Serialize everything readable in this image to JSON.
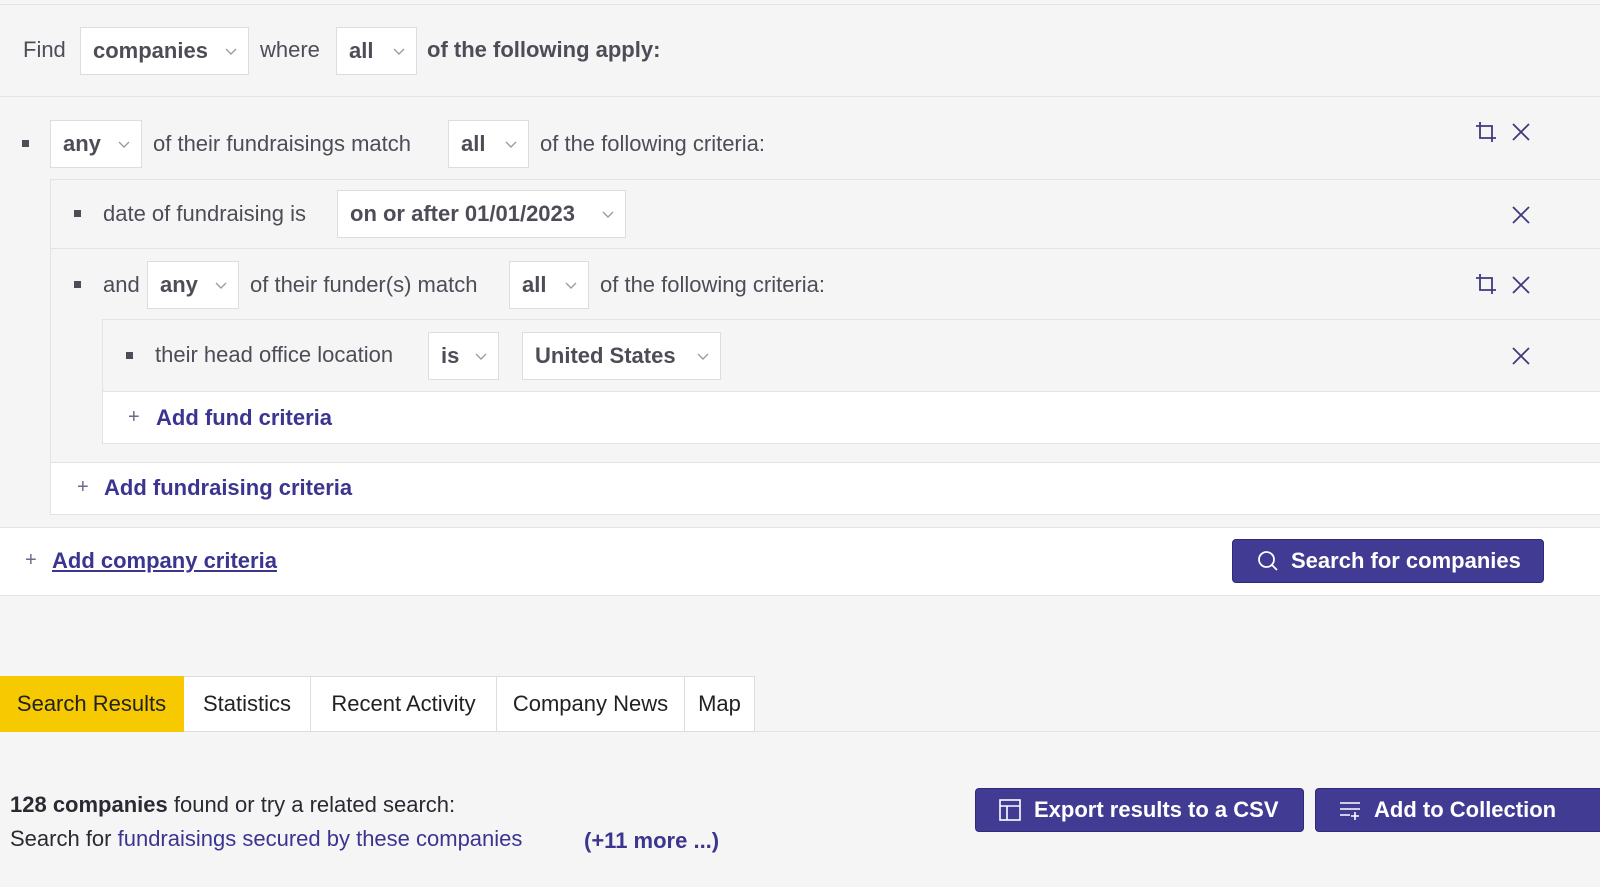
{
  "query": {
    "find_label": "Find",
    "entity_select": "companies",
    "where_label": "where",
    "match_select": "all",
    "apply_label": "of the following apply:"
  },
  "fundraising_group": {
    "quantifier": "any",
    "middle_label": "of their fundraisings match",
    "match": "all",
    "tail_label": "of the following criteria:",
    "date_rule": {
      "label": "date of fundraising is",
      "value": "on or after 01/01/2023"
    },
    "funder_group": {
      "and_label": "and",
      "quantifier": "any",
      "middle_label": "of their funder(s) match",
      "match": "all",
      "tail_label": "of the following criteria:",
      "location_rule": {
        "label": "their head office location",
        "operator": "is",
        "value": "United States"
      },
      "add_fund_label": "Add fund criteria"
    },
    "add_fundraising_label": "Add fundraising criteria"
  },
  "add_company_label": "Add company criteria",
  "search_button": "Search for companies",
  "tabs": [
    {
      "label": "Search Results",
      "active": true
    },
    {
      "label": "Statistics",
      "active": false
    },
    {
      "label": "Recent Activity",
      "active": false
    },
    {
      "label": "Company News",
      "active": false
    },
    {
      "label": "Map",
      "active": false
    }
  ],
  "results": {
    "count_label": "128 companies",
    "found_text": " found or try a related search:",
    "search_for_label": "Search for ",
    "related_link": "fundraisings secured by these companies",
    "more_link": "(+11 more ...)"
  },
  "actions": {
    "export_label": "Export results to a CSV",
    "collection_label": "Add to Collection"
  },
  "colors": {
    "primary": "#413b93",
    "link": "#3b3590",
    "active_tab": "#f7c900"
  }
}
